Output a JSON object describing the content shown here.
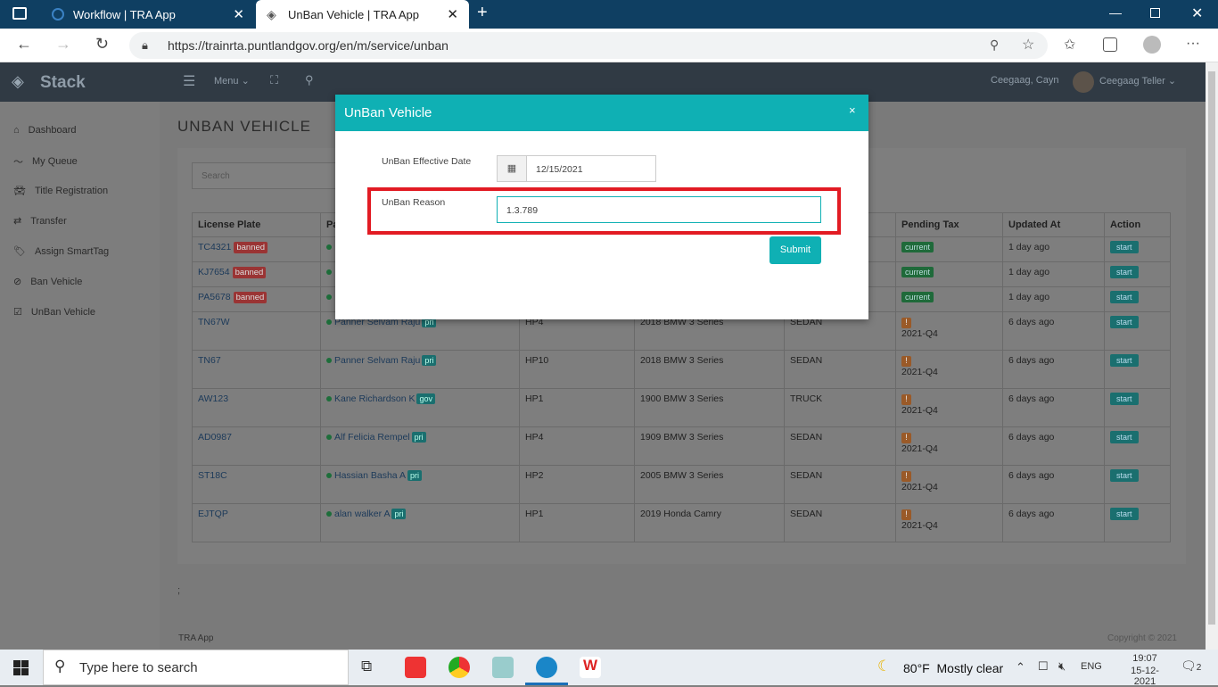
{
  "browser": {
    "tabs": [
      {
        "label": "Workflow | TRA App"
      },
      {
        "label": "UnBan Vehicle | TRA App"
      }
    ],
    "url": "https://trainrta.puntlandgov.org/en/m/service/unban"
  },
  "app": {
    "brand": "Stack",
    "menu_label": "Menu",
    "user_short": "Ceegaag, Cayn",
    "user_name": "Ceegaag Teller",
    "page_title": "UNBAN VEHICLE",
    "search_placeholder": "Search",
    "footer_left": "TRA App",
    "footer_right": "Copyright © 2021",
    "semicolon": ";"
  },
  "sidebar": {
    "items": [
      {
        "label": "Dashboard",
        "icon": "home-icon"
      },
      {
        "label": "My Queue",
        "icon": "trend-icon"
      },
      {
        "label": "Title Registration",
        "icon": "car-icon"
      },
      {
        "label": "Transfer",
        "icon": "transfer-icon"
      },
      {
        "label": "Assign SmartTag",
        "icon": "tag-icon"
      },
      {
        "label": "Ban Vehicle",
        "icon": "ban-icon"
      },
      {
        "label": "UnBan Vehicle",
        "icon": "check-icon"
      }
    ]
  },
  "table": {
    "headers": {
      "plate": "License Plate",
      "owner": "Pa",
      "pending": "Pending Tax",
      "updated": "Updated At",
      "action": "Action"
    },
    "rows": [
      {
        "plate": "TC4321",
        "banned": "banned",
        "owner": "",
        "owner_badge": "",
        "hp": "",
        "model": "",
        "type": "",
        "tax": "current",
        "tax_q": "",
        "updated": "1 day ago",
        "action": "start"
      },
      {
        "plate": "KJ7654",
        "banned": "banned",
        "owner": "",
        "owner_badge": "",
        "hp": "",
        "model": "",
        "type": "",
        "tax": "current",
        "tax_q": "",
        "updated": "1 day ago",
        "action": "start"
      },
      {
        "plate": "PA5678",
        "banned": "banned",
        "owner": "",
        "owner_badge": "",
        "hp": "",
        "model": "",
        "type": "",
        "tax": "current",
        "tax_q": "",
        "updated": "1 day ago",
        "action": "start"
      },
      {
        "plate": "TN67W",
        "banned": "",
        "owner": "Panner Selvam Raju",
        "owner_badge": "pri",
        "hp": "HP4",
        "model": "2018 BMW 3 Series",
        "type": "SEDAN",
        "tax": "",
        "tax_q": "2021-Q4",
        "updated": "6 days ago",
        "action": "start"
      },
      {
        "plate": "TN67",
        "banned": "",
        "owner": "Panner Selvam Raju",
        "owner_badge": "pri",
        "hp": "HP10",
        "model": "2018 BMW 3 Series",
        "type": "SEDAN",
        "tax": "",
        "tax_q": "2021-Q4",
        "updated": "6 days ago",
        "action": "start"
      },
      {
        "plate": "AW123",
        "banned": "",
        "owner": "Kane Richardson K",
        "owner_badge": "gov",
        "hp": "HP1",
        "model": "1900 BMW 3 Series",
        "type": "TRUCK",
        "tax": "",
        "tax_q": "2021-Q4",
        "updated": "6 days ago",
        "action": "start"
      },
      {
        "plate": "AD0987",
        "banned": "",
        "owner": "Alf Felicia Rempel",
        "owner_badge": "pri",
        "hp": "HP4",
        "model": "1909 BMW 3 Series",
        "type": "SEDAN",
        "tax": "",
        "tax_q": "2021-Q4",
        "updated": "6 days ago",
        "action": "start"
      },
      {
        "plate": "ST18C",
        "banned": "",
        "owner": "Hassian Basha A",
        "owner_badge": "pri",
        "hp": "HP2",
        "model": "2005 BMW 3 Series",
        "type": "SEDAN",
        "tax": "",
        "tax_q": "2021-Q4",
        "updated": "6 days ago",
        "action": "start"
      },
      {
        "plate": "EJTQP",
        "banned": "",
        "owner": "alan walker A",
        "owner_badge": "pri",
        "hp": "HP1",
        "model": "2019 Honda Camry",
        "type": "SEDAN",
        "tax": "",
        "tax_q": "2021-Q4",
        "updated": "6 days ago",
        "action": "start"
      }
    ]
  },
  "modal": {
    "title": "UnBan Vehicle",
    "close": "×",
    "date_label": "UnBan Effective Date",
    "date_value": "12/15/2021",
    "reason_label": "UnBan Reason",
    "reason_value": "1.3.789",
    "submit": "Submit"
  },
  "taskbar": {
    "search": "Type here to search",
    "weather": "80°F  Mostly clear",
    "lang": "ENG",
    "time": "19:07",
    "date": "15-12-2021",
    "notif": "2"
  },
  "colors": {
    "teal": "#0fb0b4",
    "highlight": "#e21b23",
    "header": "#0f3f62"
  }
}
